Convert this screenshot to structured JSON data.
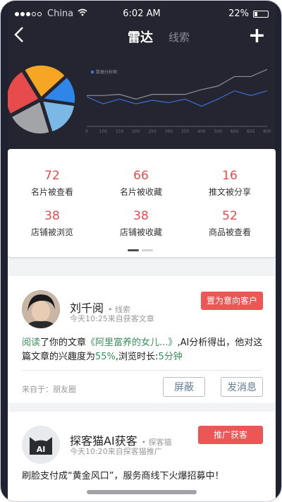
{
  "status": {
    "carrier": "China",
    "time": "6:02 AM",
    "battery": "22%"
  },
  "nav": {
    "title": "雷达",
    "subtitle": "线索"
  },
  "chart_data": {
    "type": "line",
    "legend": "数据分析图",
    "x": [
      "0",
      "100",
      "150",
      "200",
      "250",
      "300",
      "350",
      "400",
      "500",
      "600",
      "650",
      "800"
    ],
    "series": [
      {
        "color": "#3a6fd6",
        "values": [
          50,
          38,
          46,
          38,
          44,
          40,
          46,
          34,
          46,
          60,
          52,
          60
        ]
      },
      {
        "color": "#8c8f98",
        "values": [
          52,
          52,
          54,
          46,
          54,
          54,
          54,
          62,
          68,
          84,
          84,
          96
        ]
      }
    ],
    "pie": [
      {
        "color": "#f6a623",
        "value": 22
      },
      {
        "color": "#2f86e8",
        "value": 14
      },
      {
        "color": "#7cb8e6",
        "value": 18
      },
      {
        "color": "#a3a4a7",
        "value": 22
      },
      {
        "color": "#e84b4b",
        "value": 24
      }
    ]
  },
  "stats": [
    {
      "value": "72",
      "label": "名片被查看"
    },
    {
      "value": "66",
      "label": "名片被收藏"
    },
    {
      "value": "16",
      "label": "推文被分享"
    },
    {
      "value": "38",
      "label": "店铺被浏览"
    },
    {
      "value": "38",
      "label": "店铺被收藏"
    },
    {
      "value": "52",
      "label": "商品被查看"
    }
  ],
  "card1": {
    "name": "刘千阅",
    "tag": "• 线索",
    "time": "今天10:25来自获客文章",
    "action": "置为意向客户",
    "msg": {
      "p1": "阅读",
      "p2": "了你的文章",
      "p3": "《阿里富养的女儿...》",
      "p4": ",AI分析得出，他对这篇文章的兴趣度为",
      "p5": "55%",
      "p6": ",浏览时长:",
      "p7": "5分钟"
    },
    "from": "来自于：朋友圈",
    "btn_block": "屏蔽",
    "btn_msg": "发消息"
  },
  "card2": {
    "name": "探客猫AI获客",
    "tag": "• 探客猫",
    "time": "今天10:20来自探客猫推广",
    "action": "推广获客",
    "avatar_text": "AI",
    "msg": "刷脸支付成“黄金风口”，服务商线下火爆招募中！"
  }
}
